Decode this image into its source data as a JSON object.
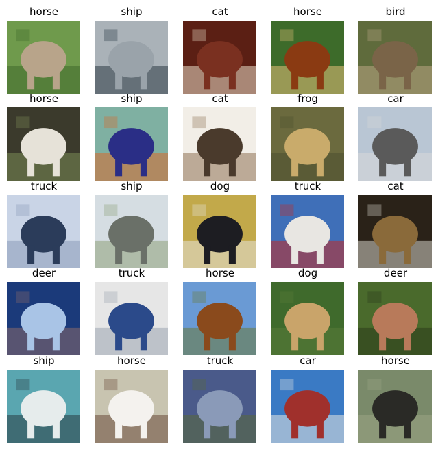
{
  "grid": {
    "rows": 5,
    "cols": 5,
    "images": [
      {
        "label": "horse",
        "palette": [
          "#6f9a4c",
          "#b8a48a",
          "#3f6a2c"
        ]
      },
      {
        "label": "ship",
        "palette": [
          "#aab2b8",
          "#9aa3aa",
          "#2b3a44"
        ]
      },
      {
        "label": "cat",
        "palette": [
          "#5b1f14",
          "#7a3020",
          "#e9ddc7"
        ]
      },
      {
        "label": "horse",
        "palette": [
          "#3d6b2a",
          "#8a3a12",
          "#e6c079"
        ]
      },
      {
        "label": "bird",
        "palette": [
          "#5f6b3c",
          "#7a6448",
          "#b9a684"
        ]
      },
      {
        "label": "horse",
        "palette": [
          "#3b3a2c",
          "#e6e2d8",
          "#7a8a55"
        ]
      },
      {
        "label": "ship",
        "palette": [
          "#7fb0a2",
          "#2a2e86",
          "#d96a2b"
        ]
      },
      {
        "label": "cat",
        "palette": [
          "#f2eee7",
          "#4a3a2c",
          "#8f7356"
        ]
      },
      {
        "label": "frog",
        "palette": [
          "#6b6a3e",
          "#c9ab6b",
          "#4c4f2f"
        ]
      },
      {
        "label": "car",
        "palette": [
          "#b9c6d4",
          "#5a5a5a",
          "#d8d8d8"
        ]
      },
      {
        "label": "truck",
        "palette": [
          "#c9d4e6",
          "#2b3c5a",
          "#8a9bb8"
        ]
      },
      {
        "label": "ship",
        "palette": [
          "#d5dde2",
          "#6a7068",
          "#8fa07a"
        ]
      },
      {
        "label": "dog",
        "palette": [
          "#c2a94a",
          "#1d1d22",
          "#e6e2da"
        ]
      },
      {
        "label": "truck",
        "palette": [
          "#3f6fb8",
          "#e8e6e2",
          "#c22a24"
        ]
      },
      {
        "label": "cat",
        "palette": [
          "#2a2218",
          "#8a6a3a",
          "#d4d2c8"
        ]
      },
      {
        "label": "deer",
        "palette": [
          "#1b3a7a",
          "#a9c4e6",
          "#8a6a6a"
        ]
      },
      {
        "label": "truck",
        "palette": [
          "#e6e6e6",
          "#2b4a8a",
          "#9aa4b0"
        ]
      },
      {
        "label": "horse",
        "palette": [
          "#6a9ad4",
          "#8a4a1c",
          "#6a7a3a"
        ]
      },
      {
        "label": "dog",
        "palette": [
          "#3f6a2c",
          "#c9a46a",
          "#5a7a3a"
        ]
      },
      {
        "label": "deer",
        "palette": [
          "#4a6a2c",
          "#b87a5a",
          "#2c3a1c"
        ]
      },
      {
        "label": "ship",
        "palette": [
          "#5aa6b0",
          "#e6ecec",
          "#2a3c44"
        ]
      },
      {
        "label": "horse",
        "palette": [
          "#c8c4b0",
          "#f4f2ee",
          "#6a4a3a"
        ]
      },
      {
        "label": "truck",
        "palette": [
          "#4a5a8a",
          "#8a9ab8",
          "#5a6a3a"
        ]
      },
      {
        "label": "car",
        "palette": [
          "#3a7ac4",
          "#a0302c",
          "#e6e6e2"
        ]
      },
      {
        "label": "horse",
        "palette": [
          "#7a8a6a",
          "#2a2a26",
          "#9aa484"
        ]
      }
    ]
  }
}
